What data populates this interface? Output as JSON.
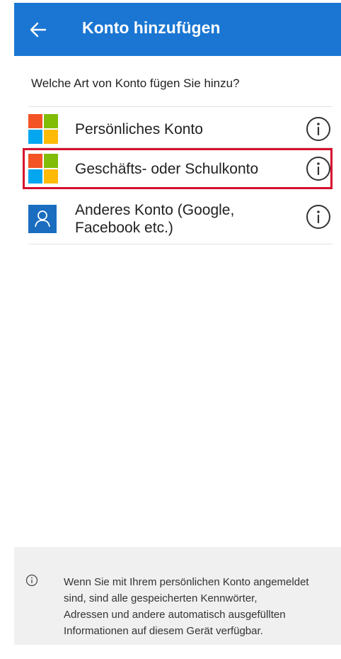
{
  "header": {
    "title": "Konto hinzufügen",
    "back_icon": "arrow-left-icon",
    "background": "#1a76d2"
  },
  "prompt": "Welche Art von Konto fügen Sie hinzu?",
  "accounts": [
    {
      "label": "Persönliches Konto",
      "icon": "microsoft-logo-icon",
      "info_icon": "info-circle-icon",
      "highlighted": false
    },
    {
      "label": "Geschäfts- oder Schulkonto",
      "icon": "microsoft-logo-icon",
      "info_icon": "info-circle-icon",
      "highlighted": true,
      "highlight_color": "#d5102e"
    },
    {
      "label_line1": "Anderes Konto (Google,",
      "label_line2": "Facebook etc.)",
      "icon": "user-icon",
      "info_icon": "info-circle-icon",
      "highlighted": false
    }
  ],
  "footer": {
    "icon": "info-circle-icon",
    "lines": [
      "Wenn Sie mit Ihrem persönlichen Konto angemeldet",
      "sind, sind alle gespeicherten Kennwörter,",
      "Adressen und andere automatisch ausgefüllten",
      "Informationen auf diesem Gerät verfügbar."
    ]
  }
}
